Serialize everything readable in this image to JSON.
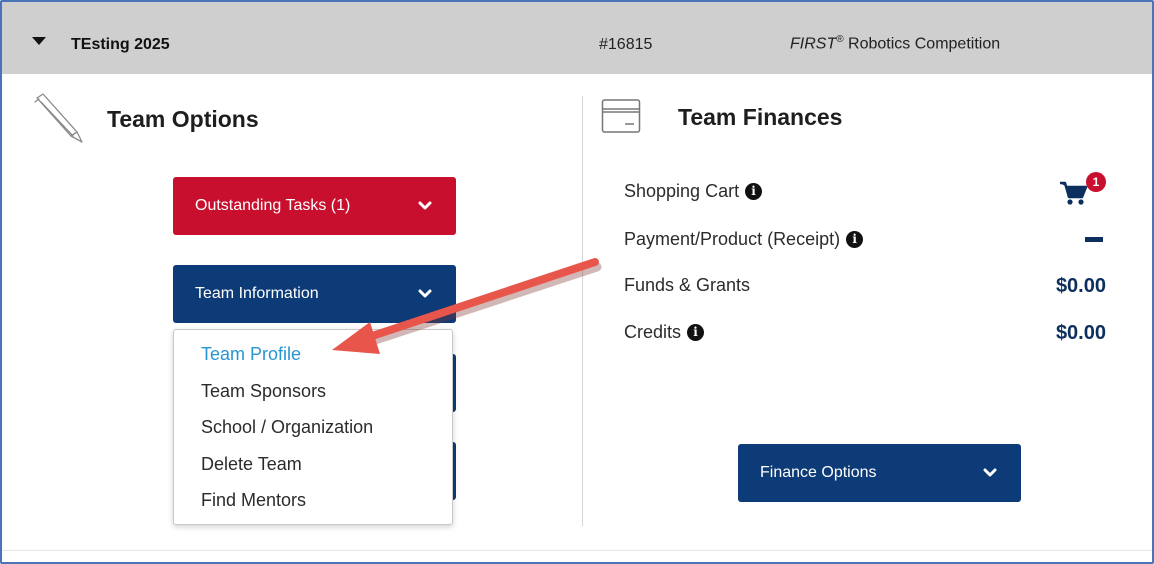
{
  "header": {
    "team_name": "TEsting 2025",
    "team_number": "#16815",
    "program_first": "FIRST",
    "program_reg": "®",
    "program_rest": " Robotics Competition"
  },
  "team_options": {
    "title": "Team Options",
    "outstanding_label": "Outstanding Tasks (1)",
    "team_info_label": "Team Information",
    "menu_items": [
      "Team Profile",
      "Team Sponsors",
      "School / Organization",
      "Delete Team",
      "Find Mentors"
    ],
    "active_item": "Team Profile"
  },
  "team_finances": {
    "title": "Team Finances",
    "rows": [
      {
        "label": "Shopping Cart",
        "has_info": true,
        "value": ""
      },
      {
        "label": "Payment/Product (Receipt)",
        "has_info": true,
        "value": ""
      },
      {
        "label": "Funds & Grants",
        "has_info": false,
        "value": "$0.00"
      },
      {
        "label": "Credits",
        "has_info": true,
        "value": "$0.00"
      }
    ],
    "cart_count": "1",
    "finance_options_label": "Finance Options"
  },
  "icons": {
    "caret": "caret-down-icon",
    "pen": "pen-icon",
    "card": "credit-card-icon",
    "cart": "shopping-cart-icon",
    "info": "info-circle-icon",
    "chevron": "chevron-down-icon"
  },
  "colors": {
    "header_bg": "#cfcfcf",
    "danger": "#c8102e",
    "navy": "#0d3b78",
    "link": "#2a95d5",
    "value": "#0d2f5e",
    "arrow": "#e8554a"
  }
}
